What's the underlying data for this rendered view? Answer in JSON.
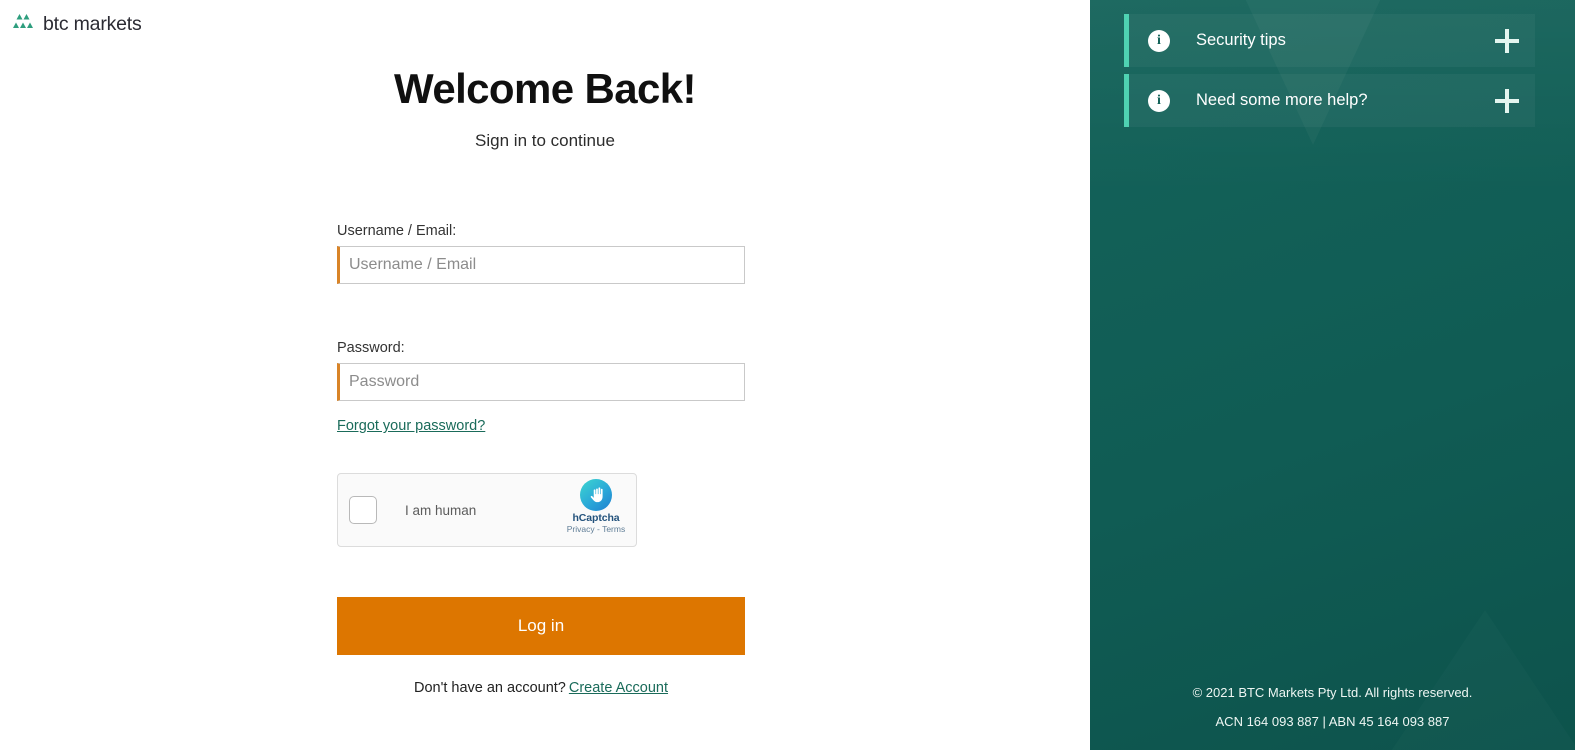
{
  "brand": {
    "name": "btc markets",
    "logo_icon": "pyramid-triangles-icon",
    "logo_color": "#2e9e7e"
  },
  "login": {
    "title": "Welcome Back!",
    "subtitle": "Sign in to continue",
    "username": {
      "label": "Username / Email:",
      "placeholder": "Username / Email",
      "value": ""
    },
    "password": {
      "label": "Password:",
      "placeholder": "Password",
      "value": ""
    },
    "forgot_password_label": "Forgot your password?",
    "submit_label": "Log in",
    "signup_prompt": "Don't have an account?",
    "signup_link_label": "Create Account",
    "accent_color": "#dd7600",
    "link_color": "#1a6b5a",
    "input_accent_color": "#d98428"
  },
  "captcha": {
    "checkbox_label": "I am human",
    "brand_label": "hCaptcha",
    "privacy_label": "Privacy",
    "separator": "-",
    "terms_label": "Terms",
    "logo_icon": "hcaptcha-hand-icon",
    "checked": false
  },
  "info_panel": {
    "background_color": "#14635a",
    "accent_bar_color": "#4fd2b2",
    "accordions": [
      {
        "icon": "info-circle-icon",
        "label": "Security tips",
        "toggle_icon": "plus-icon",
        "expanded": false
      },
      {
        "icon": "info-circle-icon",
        "label": "Need some more help?",
        "toggle_icon": "plus-icon",
        "expanded": false
      }
    ],
    "footer": {
      "copyright": "© 2021 BTC Markets Pty Ltd. All rights reserved.",
      "registration": "ACN 164 093 887 | ABN 45 164 093 887"
    }
  }
}
